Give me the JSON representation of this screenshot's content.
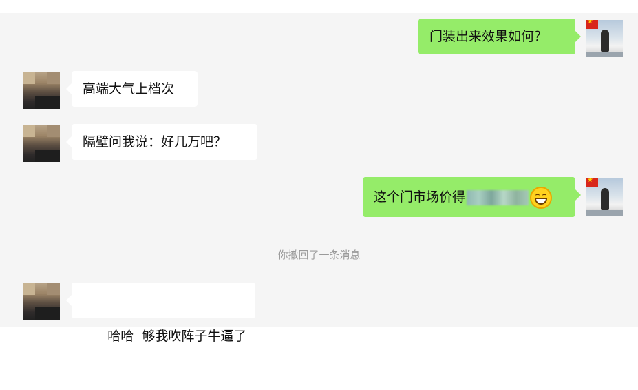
{
  "messages": [
    {
      "side": "right",
      "text": "门装出来效果如何？"
    },
    {
      "side": "left",
      "text": "高端大气上档次"
    },
    {
      "side": "left",
      "text": "隔壁问我说：好几万吧？"
    },
    {
      "side": "right",
      "text": "这个门市场价得",
      "redacted": true,
      "emoji": "grinning-face-icon"
    },
    {
      "system": "你撤回了一条消息"
    },
    {
      "side": "left",
      "text": "哈哈  够我吹阵子牛逼了"
    }
  ],
  "colors": {
    "background": "#f5f5f5",
    "outgoing_bubble": "#95ec69",
    "incoming_bubble": "#ffffff",
    "system_text": "#9a9a9a"
  }
}
